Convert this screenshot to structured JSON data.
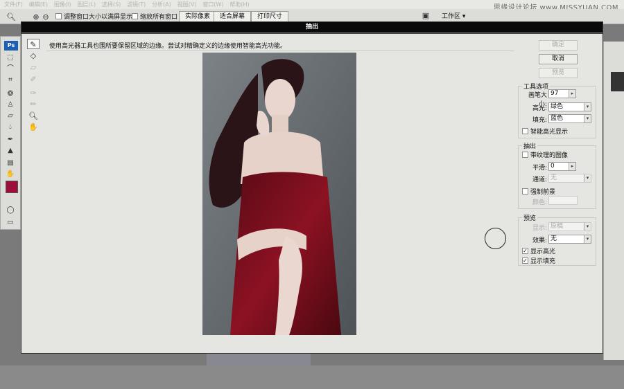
{
  "menubar": {
    "items": [
      "文件(F)",
      "编辑(E)",
      "图像(I)",
      "图层(L)",
      "选择(S)",
      "滤镜(T)",
      "分析(A)",
      "视图(V)",
      "窗口(W)",
      "帮助(H)"
    ],
    "watermark": "思缘设计论坛 www.MISSYUAN.COM"
  },
  "options_bar": {
    "checkbox_resize_label": "调整窗口大小以满屏显示",
    "checkbox_zoom_all_label": "缩放所有窗口",
    "btn_actual_pixels": "实际像素",
    "btn_fit_screen": "适合屏幕",
    "btn_print_size": "打印尺寸",
    "workspace_label": "工作区 ▾"
  },
  "toolbox": {
    "logo": "Ps"
  },
  "dialog": {
    "title": "抽出",
    "instruction": "使用高光器工具也围所要保留区域的边缘。尝试对精确定义的边缘使用智能高光功能。",
    "buttons": {
      "ok": "确定",
      "cancel": "取消",
      "preview": "预览"
    },
    "tool_options": {
      "title": "工具选项",
      "brush_size_label": "画笔大小:",
      "brush_size_value": "97",
      "highlight_label": "高光:",
      "highlight_value": "绿色",
      "fill_label": "填充:",
      "fill_value": "蓝色",
      "smart_highlight_label": "智能高光显示"
    },
    "extraction": {
      "title": "抽出",
      "textured_label": "带纹理的图像",
      "smooth_label": "平滑:",
      "smooth_value": "0",
      "channel_label": "通道:",
      "channel_value": "无",
      "force_fg_label": "强制前景",
      "color_label": "颜色:"
    },
    "preview_group": {
      "title": "预览",
      "show_label": "显示:",
      "show_value": "原稿",
      "effect_label": "效果:",
      "effect_value": "无",
      "show_highlight_label": "显示高光",
      "show_fill_label": "显示填充",
      "show_highlight_checked": true,
      "show_fill_checked": true
    }
  },
  "colors": {
    "foreground": "#9b0f3a",
    "dialog_bg": "#e5e5e2",
    "titlebar": "#0a0a0a",
    "photo_bg": "#62686d",
    "dress": "#7a0d1e"
  }
}
